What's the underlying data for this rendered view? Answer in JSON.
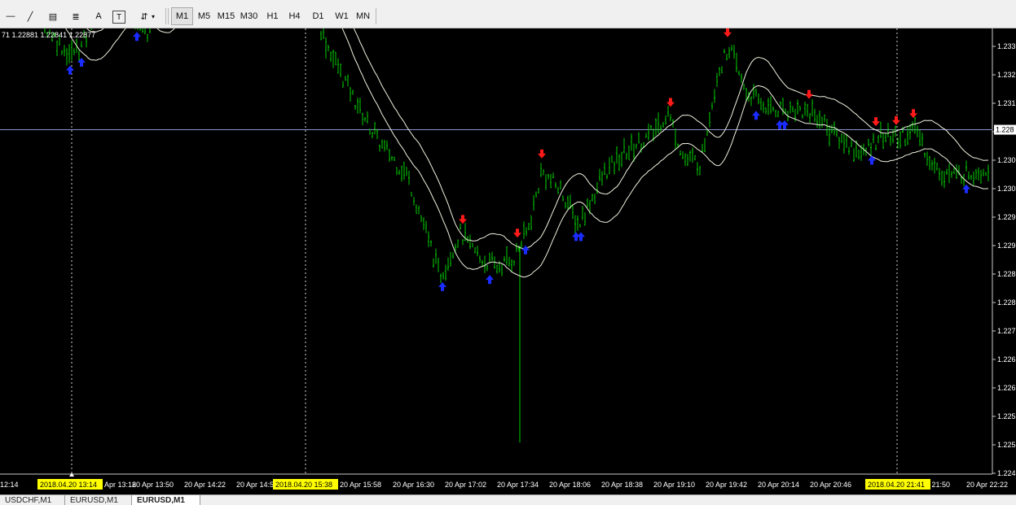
{
  "window": {
    "background": "#000000",
    "foreground": "#ffffff"
  },
  "toolbar": {
    "tools": [
      {
        "icon": "horizontal-line-icon",
        "glyph": "—"
      },
      {
        "icon": "trendline-icon",
        "glyph": "╱"
      },
      {
        "icon": "fibonacci-fan-icon",
        "glyph": "▤"
      },
      {
        "icon": "fibonacci-retracement-icon",
        "glyph": "≣"
      },
      {
        "icon": "text-icon",
        "glyph": "A"
      },
      {
        "icon": "text-label-icon",
        "glyph": "T"
      },
      {
        "icon": "arrows-icon",
        "glyph": "⇵"
      }
    ],
    "timeframes": [
      "M1",
      "M5",
      "M15",
      "M30",
      "H1",
      "H4",
      "D1",
      "W1",
      "MN"
    ],
    "active_timeframe": "M1"
  },
  "ohlc_label": "71 1.22881 1.22841 1.22877",
  "chart_data": {
    "type": "candlestick",
    "symbol": "EURUSD",
    "timeframe": "M1",
    "colors": {
      "bars": "#00cc00",
      "bands": "#f0f0e0",
      "up_arrow": "#1a2cff",
      "down_arrow": "#ff1a1a",
      "grid_vline": "#d0d0d0",
      "price_line": "#8a96c8"
    },
    "ylim": [
      1.22425,
      1.22935
    ],
    "y_ticks": [
      "1.233",
      "1.232",
      "1.231",
      "1.231",
      "1.230",
      "1.230",
      "1.229",
      "1.229",
      "1.228",
      "1.228",
      "1.227",
      "1.226",
      "1.226",
      "1.225",
      "1.225",
      "1.224"
    ],
    "x_ticks": [
      "12:14",
      "20 Apr 13:18",
      "20 Apr 13:50",
      "20 Apr 14:22",
      "20 Apr 14:5",
      "20 Apr 15:58",
      "20 Apr 16:30",
      "20 Apr 17:02",
      "20 Apr 17:34",
      "20 Apr 18:06",
      "20 Apr 18:38",
      "20 Apr 19:10",
      "20 Apr 19:42",
      "20 Apr 20:14",
      "20 Apr 20:46",
      "r 21:50",
      "20 Apr 22:22"
    ],
    "highlighted_times": [
      "2018.04.20 13:14",
      "2018.04.20 15:38",
      "2018.04.20 21:41"
    ],
    "current_price": "1.228",
    "price_path": [
      [
        0,
        1.23025
      ],
      [
        30,
        1.23005
      ],
      [
        55,
        1.2296
      ],
      [
        85,
        1.22925
      ],
      [
        100,
        1.22935
      ],
      [
        120,
        1.22985
      ],
      [
        150,
        1.2299
      ],
      [
        180,
        1.2295
      ],
      [
        200,
        1.2301
      ],
      [
        215,
        1.23055
      ],
      [
        240,
        1.23035
      ],
      [
        265,
        1.2302
      ],
      [
        295,
        1.23015
      ],
      [
        320,
        1.23045
      ],
      [
        345,
        1.2306
      ],
      [
        360,
        1.2304
      ],
      [
        375,
        1.2301
      ],
      [
        400,
        1.2294
      ],
      [
        430,
        1.2288
      ],
      [
        465,
        1.2282
      ],
      [
        500,
        1.2278
      ],
      [
        520,
        1.2272
      ],
      [
        540,
        1.2266
      ],
      [
        565,
        1.2271
      ],
      [
        590,
        1.2268
      ],
      [
        610,
        1.2267
      ],
      [
        630,
        1.2268
      ],
      [
        650,
        1.2272
      ],
      [
        665,
        1.22785
      ],
      [
        690,
        1.2276
      ],
      [
        710,
        1.2272
      ],
      [
        740,
        1.2278
      ],
      [
        770,
        1.2281
      ],
      [
        800,
        1.2283
      ],
      [
        820,
        1.22855
      ],
      [
        840,
        1.228
      ],
      [
        860,
        1.22795
      ],
      [
        880,
        1.229
      ],
      [
        895,
        1.22935
      ],
      [
        915,
        1.2288
      ],
      [
        945,
        1.2286
      ],
      [
        975,
        1.2286
      ],
      [
        1000,
        1.22855
      ],
      [
        1030,
        1.22825
      ],
      [
        1060,
        1.22805
      ],
      [
        1080,
        1.2283
      ],
      [
        1100,
        1.22825
      ],
      [
        1125,
        1.22835
      ],
      [
        1145,
        1.2279
      ],
      [
        1170,
        1.2278
      ],
      [
        1195,
        1.22785
      ],
      [
        1217,
        1.2279
      ]
    ],
    "spike_low": [
      638,
      1.2246
    ],
    "down_arrows": [
      127,
      177,
      247,
      343,
      568,
      635,
      665,
      823,
      893,
      993,
      1075,
      1100,
      1121
    ],
    "up_arrows": [
      86,
      100,
      168,
      268,
      294,
      375,
      543,
      601,
      645,
      707,
      713,
      928,
      957,
      963,
      1070,
      1186
    ]
  },
  "tabs": [
    {
      "label": "USDCHF,M1",
      "active": false
    },
    {
      "label": "EURUSD,M1",
      "active": false
    },
    {
      "label": "EURUSD,M1",
      "active": true
    }
  ]
}
